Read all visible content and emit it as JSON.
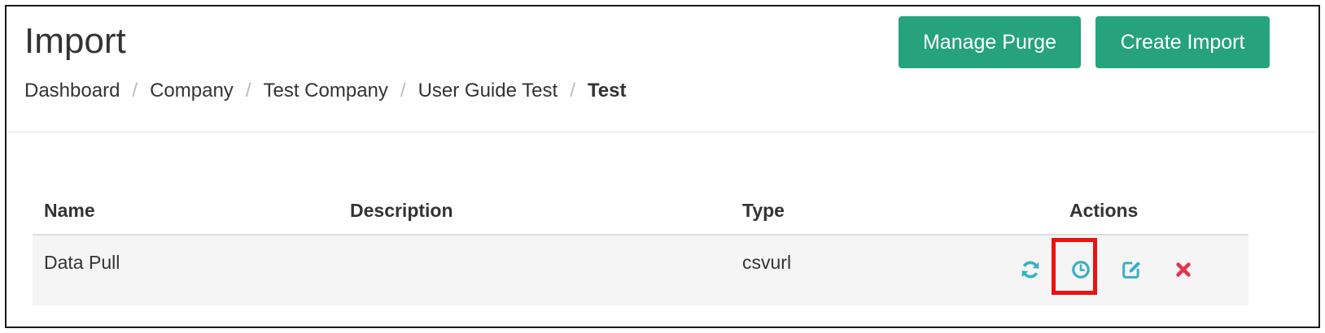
{
  "header": {
    "title": "Import",
    "buttons": {
      "manage_purge": "Manage Purge",
      "create_import": "Create Import"
    }
  },
  "breadcrumb": {
    "items": [
      "Dashboard",
      "Company",
      "Test Company",
      "User Guide Test"
    ],
    "current": "Test",
    "separator": "/"
  },
  "table": {
    "columns": [
      "Name",
      "Description",
      "Type",
      "Actions"
    ],
    "rows": [
      {
        "name": "Data Pull",
        "description": "",
        "type": "csvurl",
        "actions": [
          "refresh-icon",
          "clock-icon",
          "edit-icon",
          "delete-icon"
        ]
      }
    ]
  },
  "highlight": {
    "target": "clock-icon",
    "color": "#ee1111"
  },
  "colors": {
    "primary_button": "#26a27c",
    "action_icon": "#3ab0c3",
    "delete_icon": "#e4334f",
    "row_background": "#f5f5f5"
  }
}
